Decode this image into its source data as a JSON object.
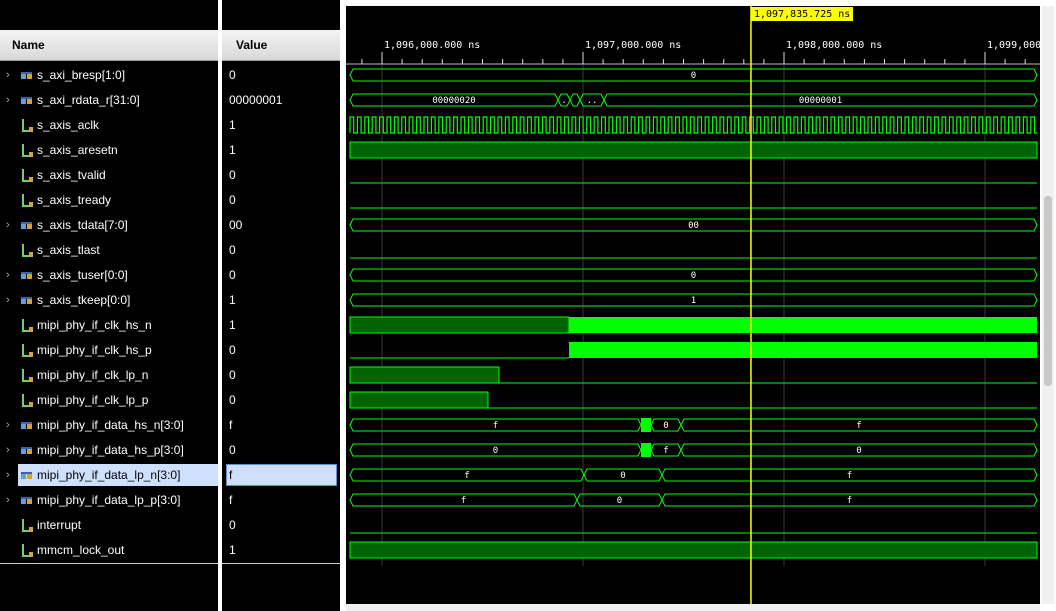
{
  "columns": {
    "name": "Name",
    "value": "Value"
  },
  "cursor": {
    "label": "1,097,835.725 ns",
    "time": 1097835.725
  },
  "timeline": {
    "ticks": [
      {
        "label": "1,096,000.000 ns",
        "time": 1096000
      },
      {
        "label": "1,097,000.000 ns",
        "time": 1097000
      },
      {
        "label": "1,098,000.000 ns",
        "time": 1098000
      },
      {
        "label": "1,099,000.",
        "time": 1099000
      }
    ]
  },
  "signals": [
    {
      "name": "s_axi_bresp[1:0]",
      "value": "0",
      "kind": "bus",
      "expandable": true,
      "wave": "bus-const",
      "label": "0"
    },
    {
      "name": "s_axi_rdata_r[31:0]",
      "value": "00000001",
      "kind": "bus",
      "expandable": true,
      "wave": "bus-rdata",
      "labels": [
        "00000020",
        ".",
        "..",
        "00000001"
      ]
    },
    {
      "name": "s_axis_aclk",
      "value": "1",
      "kind": "bit",
      "expandable": false,
      "wave": "clock"
    },
    {
      "name": "s_axis_aresetn",
      "value": "1",
      "kind": "bit",
      "expandable": false,
      "wave": "high-dim"
    },
    {
      "name": "s_axis_tvalid",
      "value": "0",
      "kind": "bit",
      "expandable": false,
      "wave": "low"
    },
    {
      "name": "s_axis_tready",
      "value": "0",
      "kind": "bit",
      "expandable": false,
      "wave": "low"
    },
    {
      "name": "s_axis_tdata[7:0]",
      "value": "00",
      "kind": "bus",
      "expandable": true,
      "wave": "bus-const",
      "label": "00"
    },
    {
      "name": "s_axis_tlast",
      "value": "0",
      "kind": "bit",
      "expandable": false,
      "wave": "low"
    },
    {
      "name": "s_axis_tuser[0:0]",
      "value": "0",
      "kind": "bus",
      "expandable": true,
      "wave": "bus-const",
      "label": "0"
    },
    {
      "name": "s_axis_tkeep[0:0]",
      "value": "1",
      "kind": "bus",
      "expandable": true,
      "wave": "bus-const",
      "label": "1"
    },
    {
      "name": "mipi_phy_if_clk_hs_n",
      "value": "1",
      "kind": "bit",
      "expandable": false,
      "wave": "clk-hs-n"
    },
    {
      "name": "mipi_phy_if_clk_hs_p",
      "value": "0",
      "kind": "bit",
      "expandable": false,
      "wave": "clk-hs-p"
    },
    {
      "name": "mipi_phy_if_clk_lp_n",
      "value": "0",
      "kind": "bit",
      "expandable": false,
      "wave": "clk-lp-n"
    },
    {
      "name": "mipi_phy_if_clk_lp_p",
      "value": "0",
      "kind": "bit",
      "expandable": false,
      "wave": "clk-lp-p"
    },
    {
      "name": "mipi_phy_if_data_hs_n[3:0]",
      "value": "f",
      "kind": "bus",
      "expandable": true,
      "wave": "bus-hs",
      "labels": [
        "f",
        "0",
        "f"
      ]
    },
    {
      "name": "mipi_phy_if_data_hs_p[3:0]",
      "value": "0",
      "kind": "bus",
      "expandable": true,
      "wave": "bus-hs",
      "labels": [
        "0",
        "f",
        "0"
      ]
    },
    {
      "name": "mipi_phy_if_data_lp_n[3:0]",
      "value": "f",
      "kind": "bus",
      "expandable": true,
      "wave": "bus-lp-n",
      "labels": [
        "f",
        "0",
        "f"
      ],
      "selected": true
    },
    {
      "name": "mipi_phy_if_data_lp_p[3:0]",
      "value": "f",
      "kind": "bus",
      "expandable": true,
      "wave": "bus-lp-p",
      "labels": [
        "f",
        "0",
        "f"
      ]
    },
    {
      "name": "interrupt",
      "value": "0",
      "kind": "bit",
      "expandable": false,
      "wave": "low"
    },
    {
      "name": "mmcm_lock_out",
      "value": "1",
      "kind": "bit",
      "expandable": false,
      "wave": "high-dim"
    }
  ],
  "colors": {
    "wave": "#00ff00",
    "wave_dim": "#006400",
    "cursor": "#ffff00",
    "cursor_label_bg": "#ffff00",
    "grid": "#3a3a3a",
    "selection": "#cfe0ff"
  },
  "icons": {
    "bit": "bit-signal-icon",
    "bus": "bus-signal-icon",
    "expander": "chevron-right-icon"
  }
}
